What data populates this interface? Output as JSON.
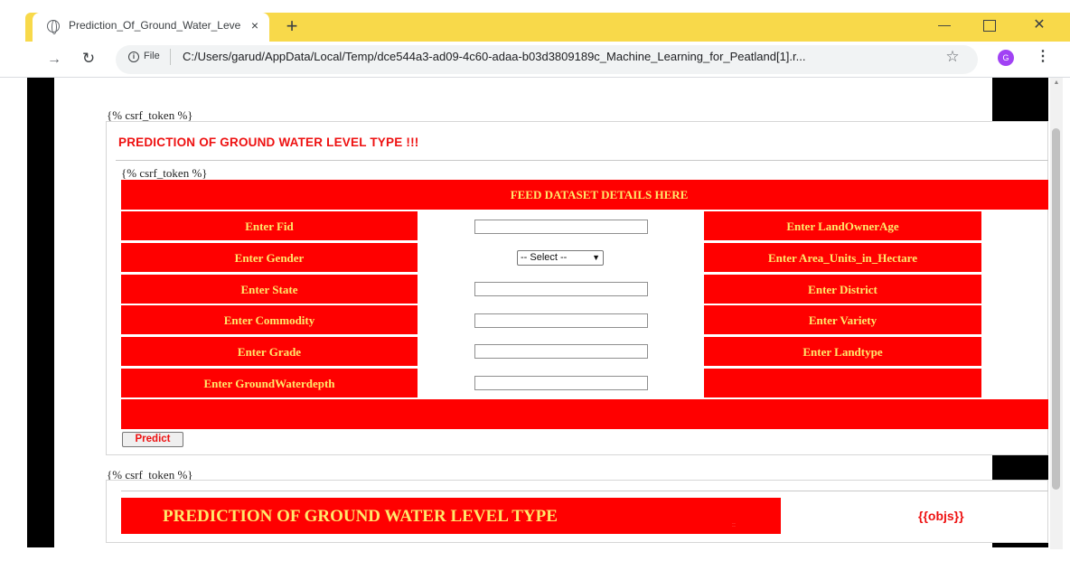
{
  "browser": {
    "tab_title": "Prediction_Of_Ground_Water_Level",
    "tab_close": "×",
    "new_tab": "+",
    "url_scheme": "File",
    "url": "C:/Users/garud/AppData/Local/Temp/dce544a3-ad09-4c60-adaa-b03d3809189c_Machine_Learning_for_Peatland[1].r...",
    "profile_initial": "G",
    "accent_color": "#f8d94a"
  },
  "page": {
    "csrf_token_text": "{% csrf_token %}",
    "title": "PREDICTION OF GROUND WATER LEVEL TYPE !!!",
    "form_header": "FEED DATASET DETAILS HERE",
    "fields_left": [
      "Enter Fid",
      "Enter Gender",
      "Enter State",
      "Enter Commodity",
      "Enter Grade",
      "Enter GroundWaterdepth"
    ],
    "fields_right": [
      "Enter LandOwnerAge",
      "Enter Area_Units_in_Hectare",
      "Enter District",
      "Enter Variety",
      "Enter Landtype"
    ],
    "gender_select": "-- Select --",
    "predict_button": "Predict",
    "result_label": "PREDICTION OF GROUND WATER LEVEL TYPE",
    "result_separator": "::",
    "result_value": "{{objs}}",
    "theme_red": "#ff0000",
    "theme_yellow": "#ffe86b"
  }
}
